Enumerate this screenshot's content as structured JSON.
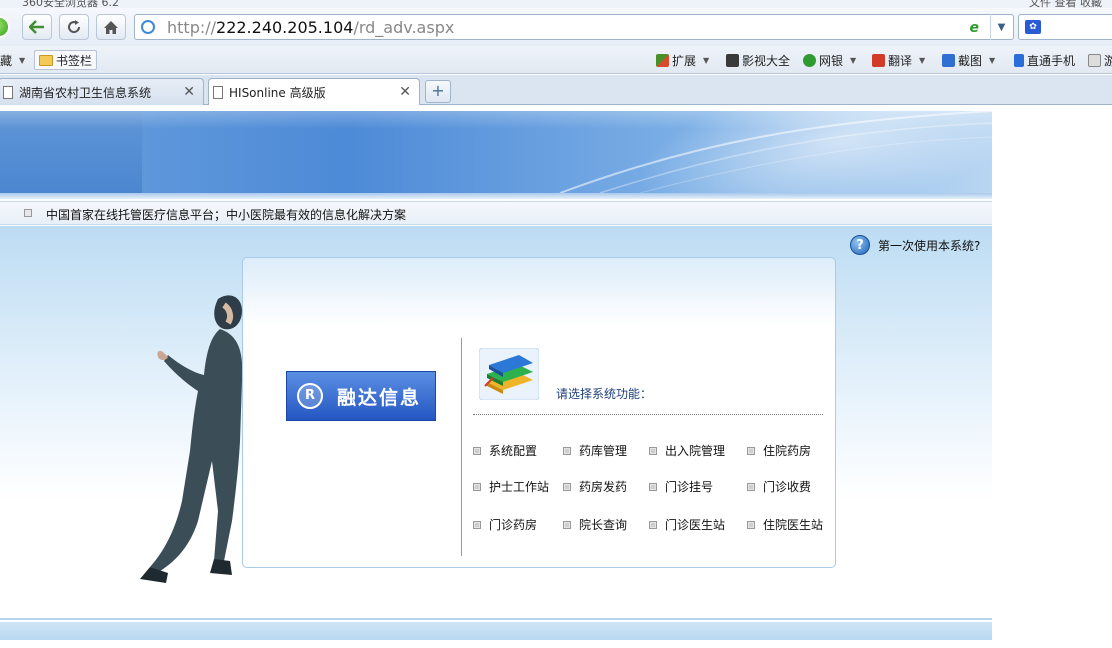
{
  "browser": {
    "title_left": "360安全浏览器 6.2",
    "title_right": "文件   查看   收藏",
    "address": {
      "proto": "http://",
      "host": "222.240.205.104",
      "path": "/rd_adv.aspx"
    }
  },
  "bookmarks": {
    "left": [
      {
        "label": "藏",
        "dropdown": true
      },
      {
        "label": "书签栏"
      }
    ],
    "right": [
      {
        "label": "扩展",
        "dropdown": true,
        "color": "#3a7a2e"
      },
      {
        "label": "影视大全",
        "color": "#2c2c2c"
      },
      {
        "label": "网银",
        "dropdown": true,
        "color": "#2f9a2f"
      },
      {
        "label": "翻译",
        "dropdown": true,
        "color": "#d23b2a"
      },
      {
        "label": "截图",
        "dropdown": true,
        "color": "#2f6fd1"
      },
      {
        "label": "直通手机",
        "color": "#2a6ed8"
      },
      {
        "label": "游",
        "color": "#777777"
      }
    ]
  },
  "tabs": [
    {
      "label": "湖南省农村卫生信息系统",
      "active": false
    },
    {
      "label": "HISonline 高级版",
      "active": true
    }
  ],
  "ticker": {
    "text": "中国首家在线托管医疗信息平台；中小医院最有效的信息化解决方案"
  },
  "help": {
    "label": "第一次使用本系统?"
  },
  "brand": {
    "symbol": "R",
    "name": "融达信息"
  },
  "prompt": "请选择系统功能：",
  "menu": {
    "row1": [
      "系统配置",
      "药库管理",
      "出入院管理",
      "住院药房"
    ],
    "row2": [
      "护士工作站",
      "药房发药",
      "门诊挂号",
      "门诊收费"
    ],
    "row3": [
      "门诊药房",
      "院长查询",
      "门诊医生站",
      "住院医生站"
    ]
  },
  "colors": {
    "accent": "#4d8ad7",
    "prompt_text": "#1f3f7a",
    "panel_border": "#a8cbe8"
  }
}
